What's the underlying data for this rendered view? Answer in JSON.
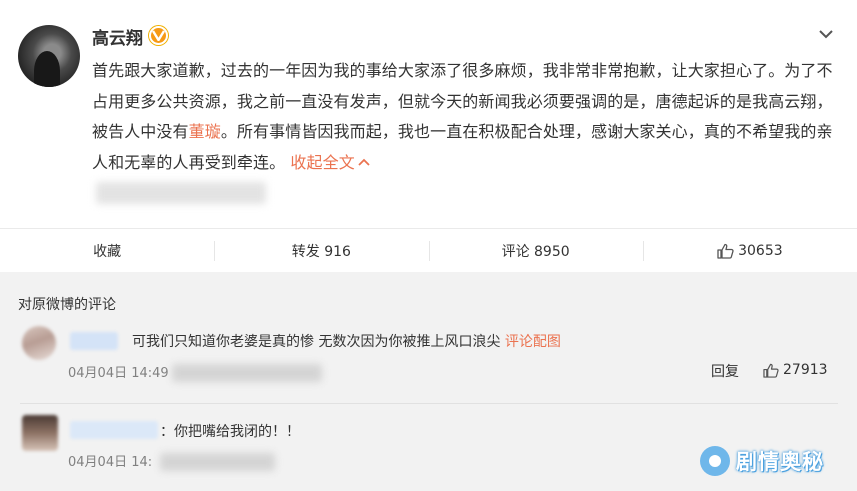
{
  "post": {
    "username": "高云翔",
    "text_parts": {
      "p1": "首先跟大家道歉，过去的一年因为我的事给大家添了很多麻烦，我非常非常抱歉，让大家担心了。为了不占用更多公共资源，我之前一直没有发声，但就今天的新闻我必须要强调的是，唐德起诉的是我高云翔，被告人中没有",
      "keyword": "董璇",
      "p2": "。所有事情皆因我而起，我也一直在积极配合处理，感谢大家关心，真的不希望我的亲人和无辜的人再受到牵连。",
      "collapse": "收起全文"
    }
  },
  "actions": {
    "favorite": "收藏",
    "repost": "转发 916",
    "comment": "评论 8950",
    "like": "30653"
  },
  "comments_section": {
    "title": "对原微博的评论",
    "comments": [
      {
        "text": "可我们只知道你老婆是真的惨 无数次因为你被推上风口浪尖",
        "link": "评论配图",
        "date": "04月04日 14:49",
        "reply": "回复",
        "likes": "27913"
      },
      {
        "text": "：你把嘴给我闭的！！",
        "date": "04月04日 14:"
      }
    ]
  },
  "watermark": {
    "text": "剧情奥秘"
  },
  "colors": {
    "accent": "#eb7350",
    "verified": "#f69a16",
    "comment_bg": "#f2f2f2"
  },
  "icons": [
    "verified-v-icon",
    "chevron-down-icon",
    "thumbs-up-icon",
    "chevron-up-icon",
    "watermark-logo-icon"
  ]
}
